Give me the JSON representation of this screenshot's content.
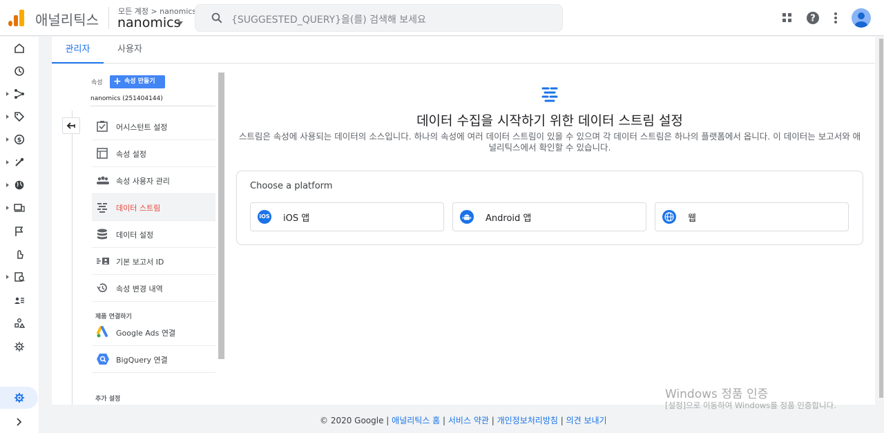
{
  "header": {
    "app_name": "애널리틱스",
    "account_crumb": "모든 계정 > nanomics",
    "account_name": "nanomics",
    "search_placeholder": "{SUGGESTED_QUERY}을(를) 검색해 보세요",
    "icons": [
      "apps-icon",
      "help-icon",
      "more-vert-icon",
      "account-avatar-icon"
    ],
    "logo_colors": [
      "#f9ab00",
      "#e37400",
      "#e37400"
    ]
  },
  "leftnav": {
    "items": [
      "home-icon",
      "clock-icon",
      "acquisition-icon",
      "tag-icon",
      "monetization-icon",
      "engagement-icon",
      "globe-icon",
      "devices-icon",
      "flag-icon",
      "conversions-icon",
      "reports-icon",
      "audience-icon",
      "explore-icon",
      "debug-icon"
    ],
    "bottom": [
      "settings-icon",
      "expand-icon"
    ]
  },
  "tabs": [
    {
      "label": "관리자",
      "active": true
    },
    {
      "label": "사용자",
      "active": false
    }
  ],
  "settings": {
    "property_label": "속성",
    "create_button": "속성 만들기",
    "property_select": "nanomics (251404144)",
    "menu": [
      {
        "label": "어시스턴트 설정",
        "icon": "checklist-icon"
      },
      {
        "label": "속성 설정",
        "icon": "layout-icon"
      },
      {
        "label": "속성 사용자 관리",
        "icon": "people-icon"
      },
      {
        "label": "데이터 스트림",
        "icon": "streams-icon",
        "selected": true
      },
      {
        "label": "데이터 설정",
        "icon": "database-icon"
      },
      {
        "label": "기본 보고서 ID",
        "icon": "id-icon"
      },
      {
        "label": "속성 변경 내역",
        "icon": "history-icon"
      }
    ],
    "linking_header": "제품 연결하기",
    "links": [
      {
        "label": "Google Ads 연결",
        "icon": "google-ads-icon"
      },
      {
        "label": "BigQuery 연결",
        "icon": "bigquery-icon"
      }
    ],
    "additional_header": "추가 설정"
  },
  "main": {
    "title": "데이터 수집을 시작하기 위한 데이터 스트림 설정",
    "description": "스트림은 속성에 사용되는 데이터의 소스입니다. 하나의 속성에 여러 데이터 스트림이 있을 수 있으며 각 데이터 스트림은 하나의 플랫폼에서 옵니다. 이 데이터는 보고서와 애널리틱스에서 확인할 수 있습니다.",
    "choose_platform": "Choose a platform",
    "platforms": [
      {
        "label": "iOS 앱",
        "badge": "iOS"
      },
      {
        "label": "Android 앱",
        "badge": "android"
      },
      {
        "label": "웹",
        "badge": "web"
      }
    ]
  },
  "footer": {
    "copyright": "© 2020 Google",
    "sep": " | ",
    "links": [
      "애널리틱스 홈",
      "서비스 약관",
      "개인정보처리방침",
      "의견 보내기"
    ]
  },
  "watermark": {
    "line1": "Windows 정품 인증",
    "line2": "[설정]으로 이동하여 Windows를 정품 인증합니다."
  }
}
